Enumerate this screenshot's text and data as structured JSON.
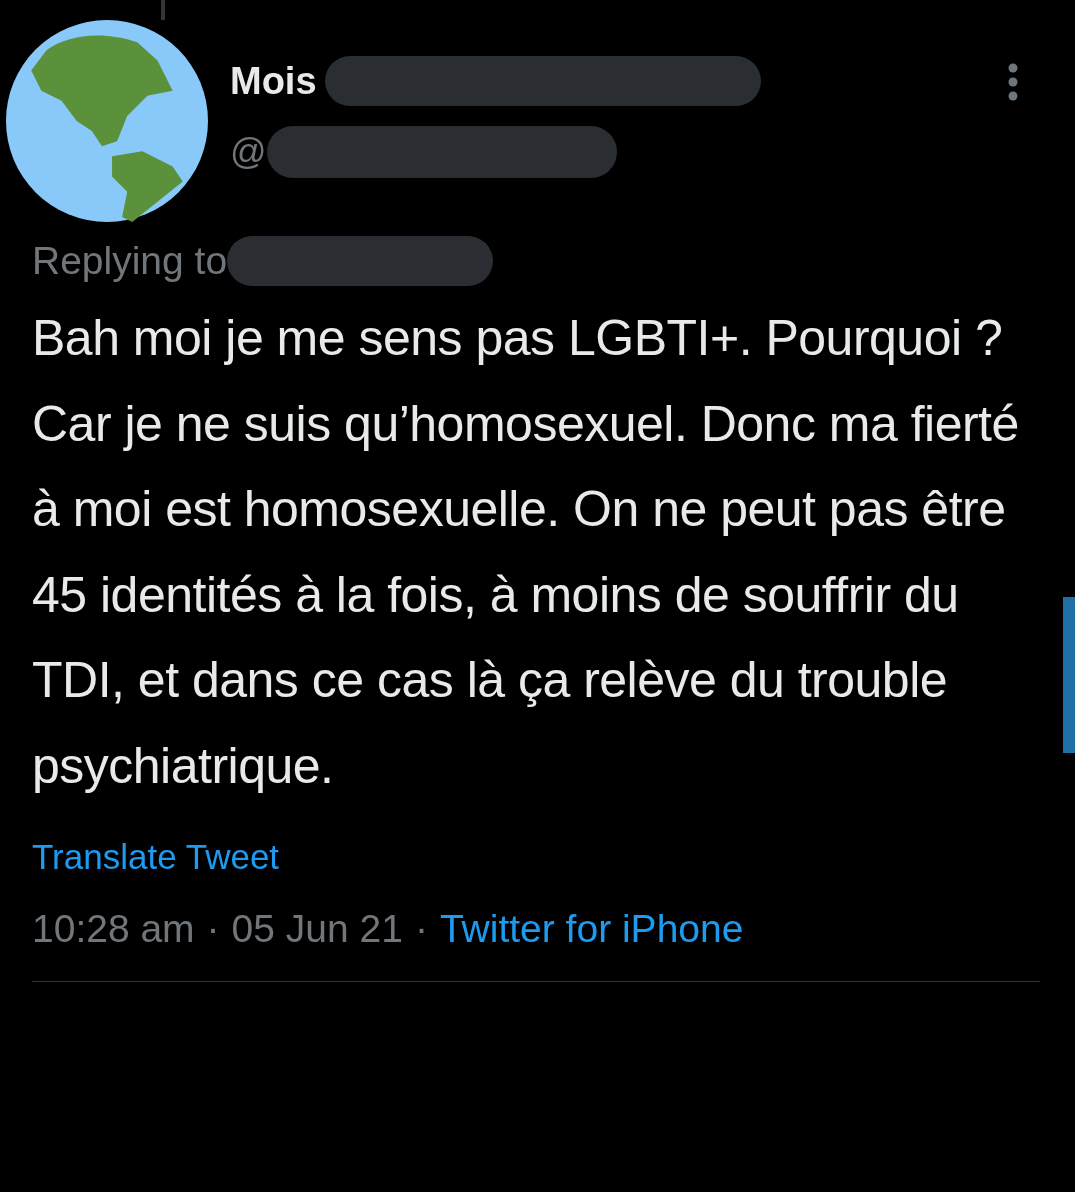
{
  "tweet": {
    "author_name": "Mois",
    "handle": "@",
    "replying_label": "Replying to",
    "text": "Bah moi je me sens pas LGBTI+. Pourquoi ? Car je ne suis qu’homosexuel. Donc ma fierté à moi est homosexuelle. On ne peut pas être 45 identités à la fois, à moins de souffrir du TDI, et dans ce cas là ça relève du trouble psychiatrique.",
    "translate_link": "Translate Tweet",
    "time": "10:28 am",
    "separator_1": "·",
    "date": "05 Jun 21",
    "separator_2": "·",
    "source": "Twitter for iPhone"
  }
}
